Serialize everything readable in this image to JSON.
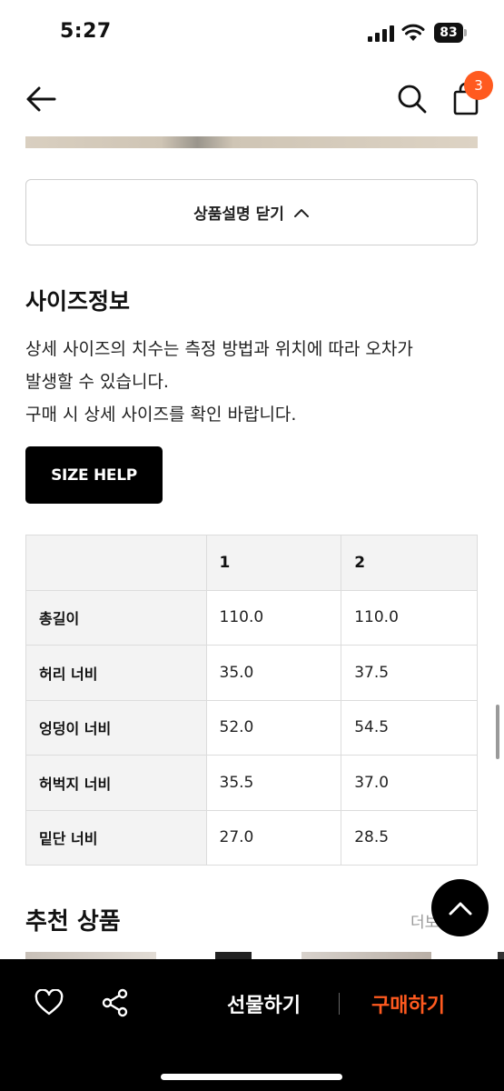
{
  "status_bar": {
    "time": "5:27",
    "battery": "83"
  },
  "nav": {
    "cart_count": "3"
  },
  "collapse_button": {
    "label": "상품설명 닫기"
  },
  "size_info": {
    "title": "사이즈정보",
    "desc_lines": [
      "상세 사이즈의 치수는 측정 방법과 위치에 따라 오차가",
      "발생할 수 있습니다.",
      "구매 시 상세 사이즈를 확인 바랍니다."
    ],
    "size_help_label": "SIZE HELP"
  },
  "size_table": {
    "headers": [
      "",
      "1",
      "2"
    ],
    "rows": [
      {
        "label": "총길이",
        "values": [
          "110.0",
          "110.0"
        ]
      },
      {
        "label": "허리 너비",
        "values": [
          "35.0",
          "37.5"
        ]
      },
      {
        "label": "엉덩이 너비",
        "values": [
          "52.0",
          "54.5"
        ]
      },
      {
        "label": "허벅지 너비",
        "values": [
          "35.5",
          "37.0"
        ]
      },
      {
        "label": "밑단 너비",
        "values": [
          "27.0",
          "28.5"
        ]
      }
    ]
  },
  "recommend": {
    "title": "추천 상품",
    "more_label": "더보"
  },
  "bottom_bar": {
    "gift_label": "선물하기",
    "buy_label": "구매하기"
  },
  "colors": {
    "accent": "#ff5a1f",
    "bar_bg": "#000000",
    "table_head_bg": "#f3f3f3"
  },
  "icons": [
    "back-arrow-icon",
    "search-icon",
    "shopping-bag-icon",
    "chevron-up-icon",
    "heart-icon",
    "share-icon",
    "arrow-up-icon"
  ]
}
